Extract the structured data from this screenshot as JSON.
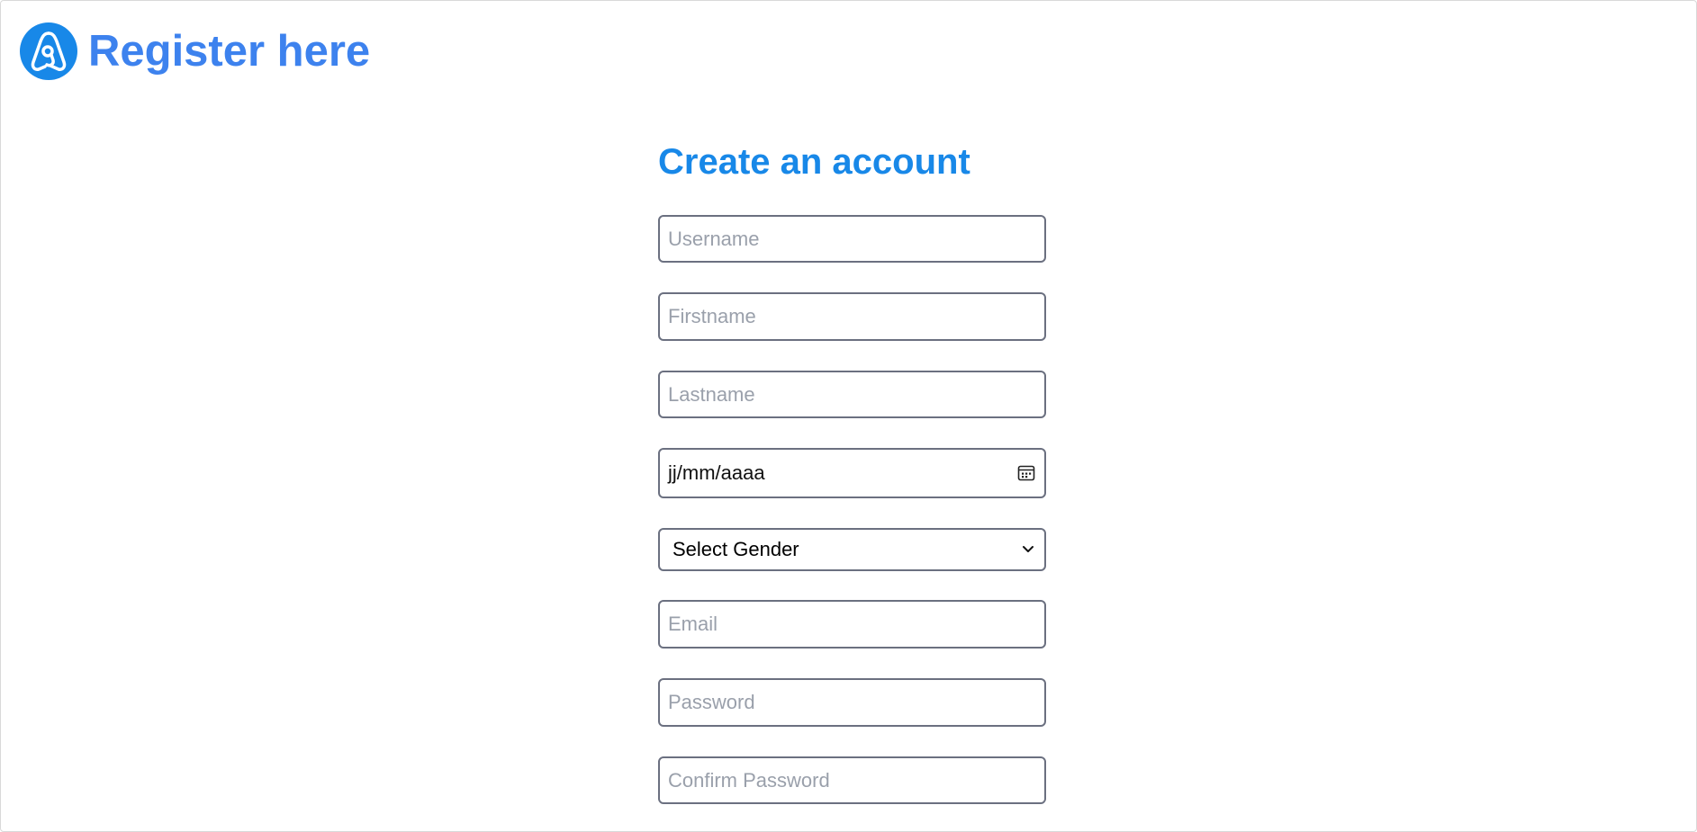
{
  "header": {
    "logo_icon": "brand-logo-icon",
    "title": "Register here"
  },
  "form": {
    "title": "Create an account",
    "username": {
      "placeholder": "Username",
      "value": ""
    },
    "firstname": {
      "placeholder": "Firstname",
      "value": ""
    },
    "lastname": {
      "placeholder": "Lastname",
      "value": ""
    },
    "birthdate": {
      "value": "jj/mm/aaaa",
      "icon": "calendar-icon"
    },
    "gender": {
      "selected": "Select Gender",
      "icon": "chevron-down-icon"
    },
    "email": {
      "placeholder": "Email",
      "value": ""
    },
    "password": {
      "placeholder": "Password",
      "value": ""
    },
    "confirm_password": {
      "placeholder": "Confirm Password",
      "value": ""
    }
  },
  "colors": {
    "brand": "#3d82ee",
    "accent": "#1888e8",
    "field_border": "#6b7080"
  }
}
